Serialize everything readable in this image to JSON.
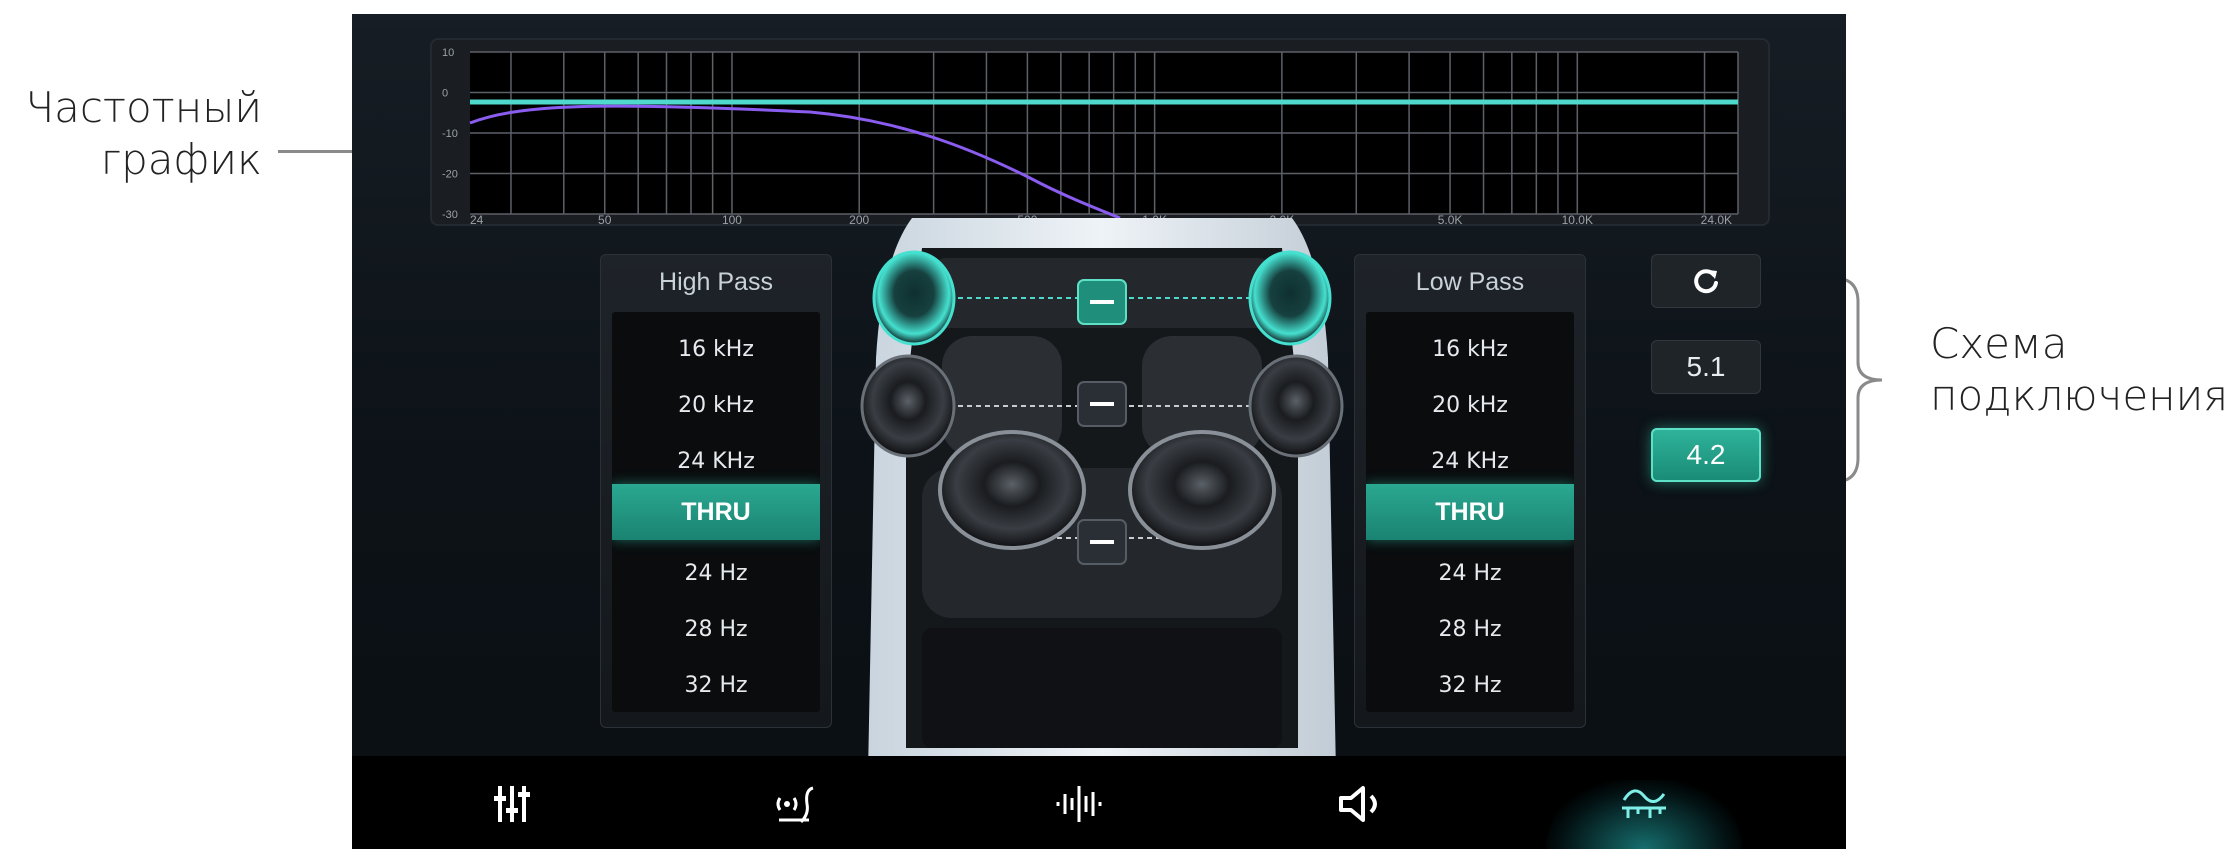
{
  "annotations": {
    "freq_graph_label_line1": "Частотный",
    "freq_graph_label_line2": "график",
    "connection_scheme_label_line1": "Схема",
    "connection_scheme_label_line2": "подключения"
  },
  "freq_graph": {
    "y_ticks": [
      "10",
      "0",
      "-10",
      "-20",
      "-30"
    ],
    "x_ticks": [
      "24",
      "50",
      "100",
      "200",
      "500",
      "1.0K",
      "2.0K",
      "5.0K",
      "10.0K",
      "24.0K"
    ],
    "colors": {
      "flat_line": "#4fd8cc",
      "rolloff_line": "#8a5cf0",
      "grid": "#5c6168"
    }
  },
  "high_pass": {
    "title": "High Pass",
    "options": [
      "16 kHz",
      "20 kHz",
      "24 KHz",
      "THRU",
      "24 Hz",
      "28 Hz",
      "32 Hz"
    ],
    "selected": "THRU"
  },
  "low_pass": {
    "title": "Low Pass",
    "options": [
      "16 kHz",
      "20 kHz",
      "24 KHz",
      "THRU",
      "24 Hz",
      "28 Hz",
      "32 Hz"
    ],
    "selected": "THRU"
  },
  "scheme_buttons": {
    "reset_icon": "refresh-icon",
    "option_51": "5.1",
    "option_42": "4.2",
    "selected": "4.2"
  },
  "bottom_nav": {
    "items": [
      "equalizer-icon",
      "sound-field-icon",
      "audio-wave-icon",
      "speaker-icon",
      "crossover-filter-icon"
    ],
    "active": "crossover-filter-icon",
    "accent": "#2fd0c8"
  }
}
